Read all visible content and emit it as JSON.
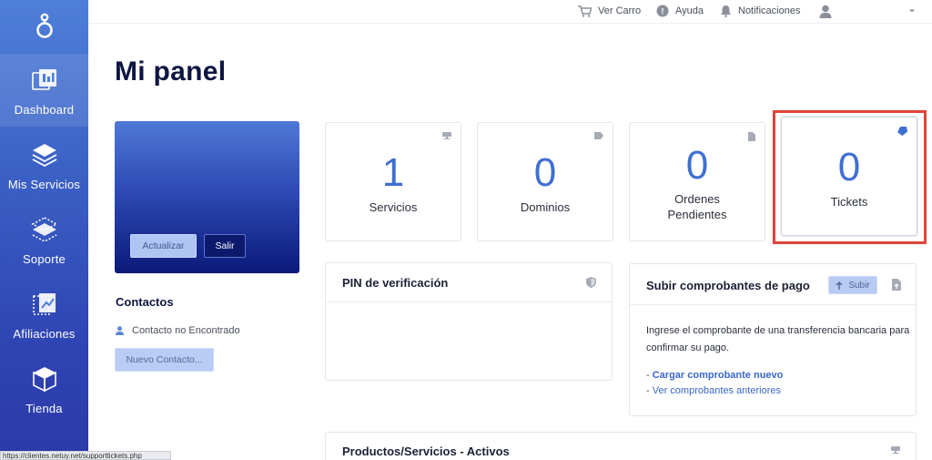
{
  "sidebar": {
    "items": [
      {
        "label": "Dashboard",
        "icon": "dashboard-icon",
        "active": true
      },
      {
        "label": "Mis Servicios",
        "icon": "layers-icon",
        "active": false
      },
      {
        "label": "Soporte",
        "icon": "support-icon",
        "active": false
      },
      {
        "label": "Afiliaciones",
        "icon": "affiliate-icon",
        "active": false
      },
      {
        "label": "Tienda",
        "icon": "cube-icon",
        "active": false
      }
    ]
  },
  "topbar": {
    "cart": "Ver Carro",
    "help": "Ayuda",
    "notifications": "Notificaciones"
  },
  "page": {
    "title": "Mi panel"
  },
  "profile": {
    "update_label": "Actualizar",
    "logout_label": "Salir"
  },
  "contacts": {
    "title": "Contactos",
    "empty": "Contacto no Encontrado",
    "new_label": "Nuevo Contacto..."
  },
  "stats": [
    {
      "value": "1",
      "label": "Servicios",
      "icon": "server-icon"
    },
    {
      "value": "0",
      "label": "Dominios",
      "icon": "tag-icon"
    },
    {
      "value": "0",
      "label": "Ordenes Pendientes",
      "label_line1": "Ordenes",
      "label_line2": "Pendientes",
      "icon": "document-icon"
    },
    {
      "value": "0",
      "label": "Tickets",
      "icon": "ticket-icon"
    }
  ],
  "pin_panel": {
    "title": "PIN de verificación"
  },
  "payment_panel": {
    "title": "Subir comprobantes de pago",
    "upload_label": "Subir",
    "description": "Ingrese el comprobante de una transferencia bancaria para confirmar su pago.",
    "link_new": "Cargar comprobante nuevo",
    "link_old": "Ver comprobantes anteriores",
    "dash": "-"
  },
  "products_panel": {
    "title": "Productos/Servicios - Activos"
  },
  "statusbar": {
    "url": "https://clientes.netuy.net/supporttickets.php"
  },
  "colors": {
    "accent": "#3f6fd1",
    "highlight": "#e0443a",
    "sidebar_top": "#4f7fd9",
    "sidebar_bottom": "#2c3aa8"
  }
}
